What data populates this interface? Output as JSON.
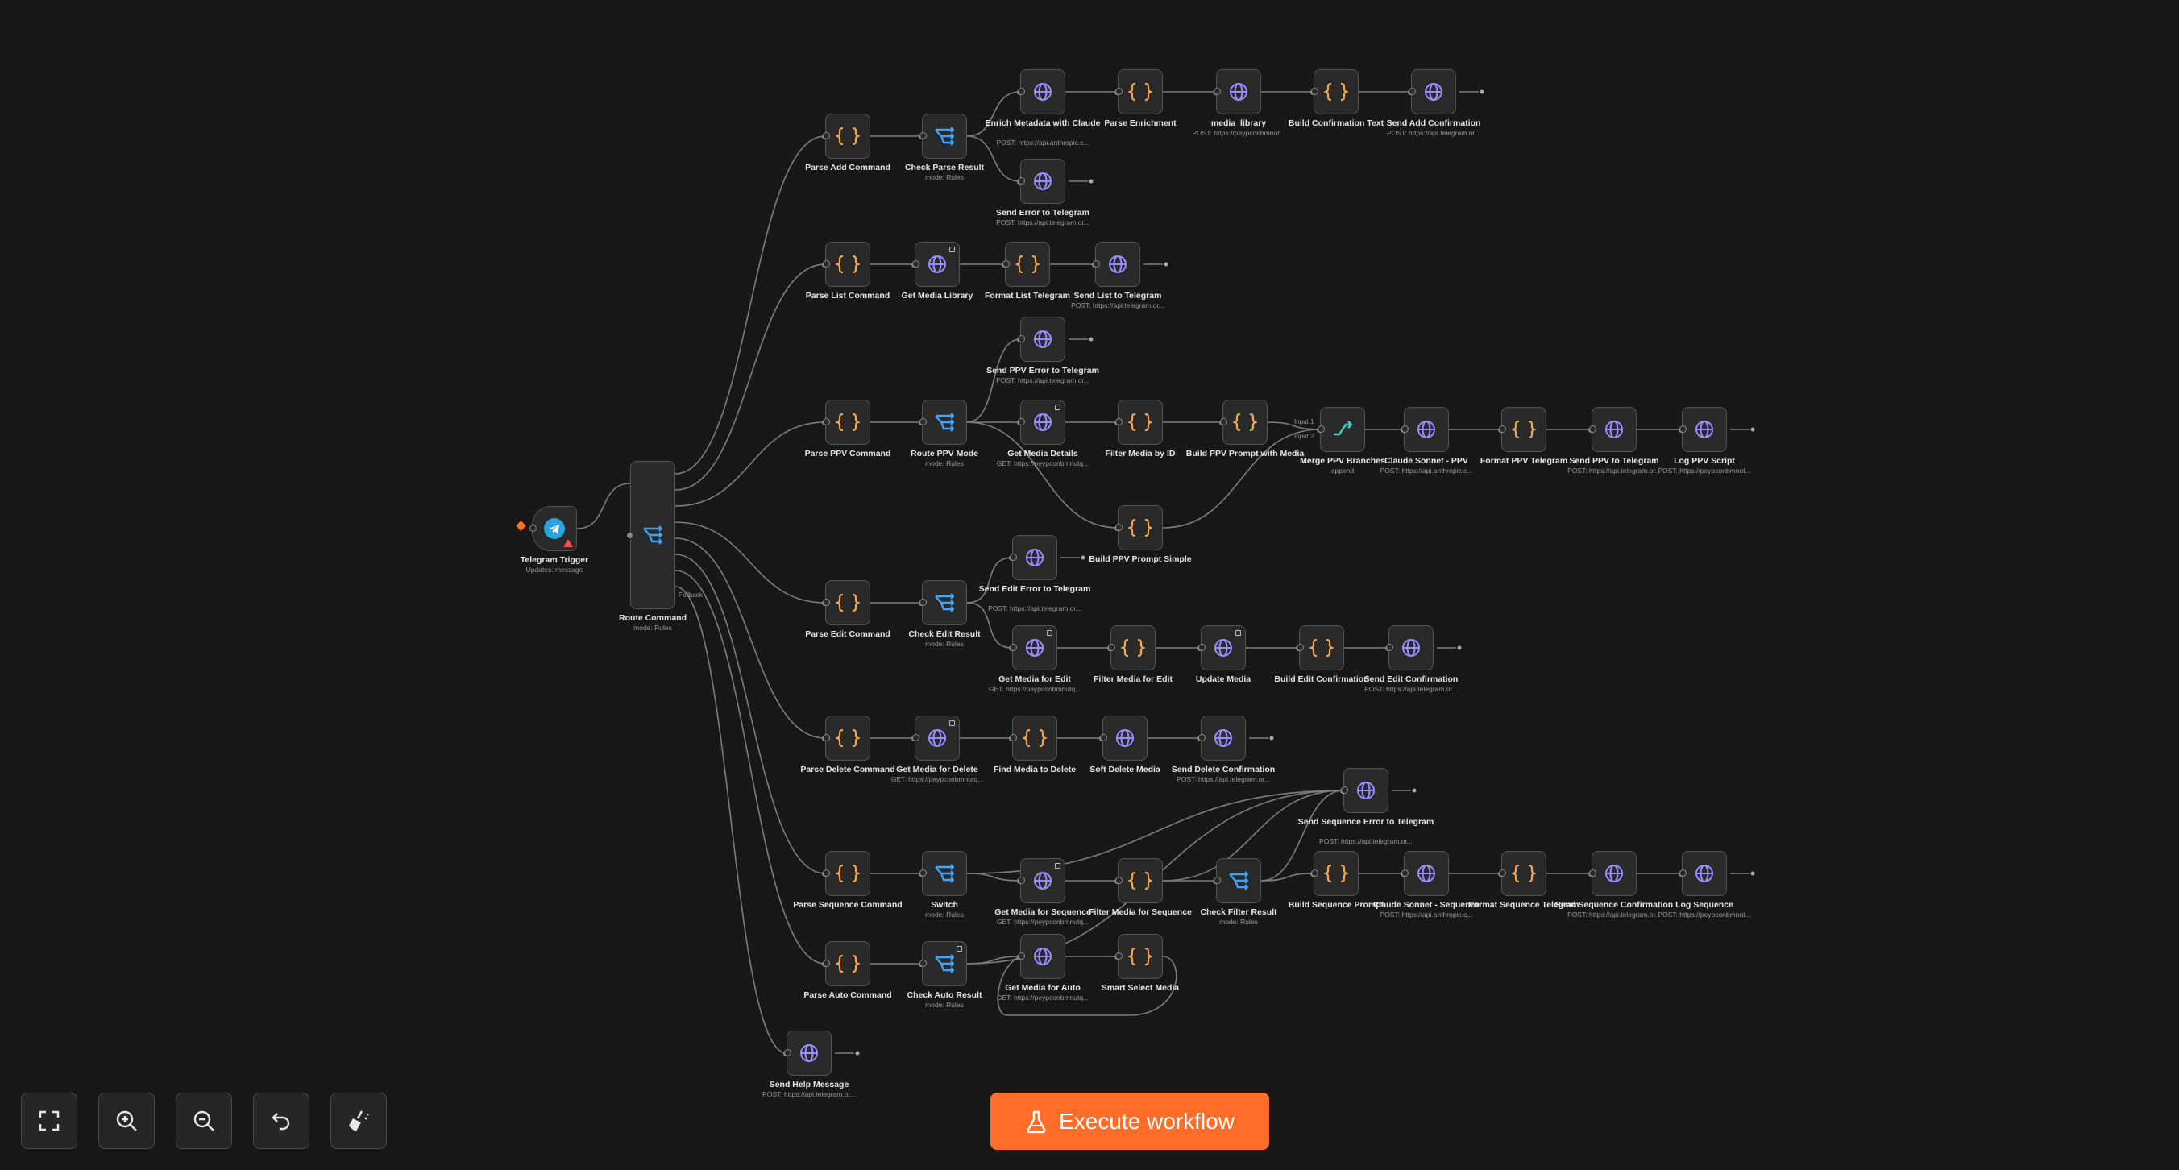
{
  "canvas": {
    "nodes": [
      {
        "id": "telegram-trigger",
        "label": "Telegram Trigger",
        "sub": "Updates: message",
        "icon": "telegram-icon",
        "kind": "trigger"
      },
      {
        "id": "route-command",
        "label": "Route Command",
        "sub": "mode: Rules",
        "icon": "switch-icon",
        "kind": "tall"
      },
      {
        "id": "parse-add-command",
        "label": "Parse Add Command",
        "sub": "",
        "icon": "code-icon"
      },
      {
        "id": "check-parse-result",
        "label": "Check Parse Result",
        "sub": "mode: Rules",
        "icon": "switch-icon"
      },
      {
        "id": "enrich-metadata",
        "label": "Enrich Metadata with Claude",
        "sub": "POST: https://api.anthropic.c...",
        "icon": "globe-icon"
      },
      {
        "id": "parse-enrichment",
        "label": "Parse Enrichment",
        "sub": "",
        "icon": "code-icon"
      },
      {
        "id": "media-library",
        "label": "media_library",
        "sub": "POST: https://peypconbmnut...",
        "icon": "globe-icon"
      },
      {
        "id": "build-confirmation-text",
        "label": "Build Confirmation Text",
        "sub": "",
        "icon": "code-icon"
      },
      {
        "id": "send-add-confirmation",
        "label": "Send Add Confirmation",
        "sub": "POST: https://api.telegram.or...",
        "icon": "globe-icon"
      },
      {
        "id": "send-error-to-telegram",
        "label": "Send Error to Telegram",
        "sub": "POST: https://api.telegram.or...",
        "icon": "globe-icon"
      },
      {
        "id": "parse-list-command",
        "label": "Parse List Command",
        "sub": "",
        "icon": "code-icon"
      },
      {
        "id": "get-media-library",
        "label": "Get Media Library",
        "sub": "",
        "icon": "globe-icon",
        "badge": true
      },
      {
        "id": "format-list-telegram",
        "label": "Format List Telegram",
        "sub": "",
        "icon": "code-icon"
      },
      {
        "id": "send-list-to-telegram",
        "label": "Send List to Telegram",
        "sub": "POST: https://api.telegram.or...",
        "icon": "globe-icon"
      },
      {
        "id": "send-ppv-error",
        "label": "Send PPV Error to Telegram",
        "sub": "POST: https://api.telegram.or...",
        "icon": "globe-icon"
      },
      {
        "id": "parse-ppv-command",
        "label": "Parse PPV Command",
        "sub": "",
        "icon": "code-icon"
      },
      {
        "id": "route-ppv-mode",
        "label": "Route PPV Mode",
        "sub": "mode: Rules",
        "icon": "switch-icon"
      },
      {
        "id": "get-media-details",
        "label": "Get Media Details",
        "sub": "GET: https://peypconbmnutq...",
        "icon": "globe-icon",
        "badge": true
      },
      {
        "id": "filter-media-by-id",
        "label": "Filter Media by ID",
        "sub": "",
        "icon": "code-icon"
      },
      {
        "id": "build-ppv-prompt-media",
        "label": "Build PPV Prompt with Media",
        "sub": "",
        "icon": "code-icon"
      },
      {
        "id": "merge-ppv-branches",
        "label": "Merge PPV Branches",
        "sub": "append",
        "icon": "merge-icon"
      },
      {
        "id": "claude-sonnet-ppv",
        "label": "Claude Sonnet - PPV",
        "sub": "POST: https://api.anthropic.c...",
        "icon": "globe-icon"
      },
      {
        "id": "format-ppv-telegram",
        "label": "Format PPV Telegram",
        "sub": "",
        "icon": "code-icon"
      },
      {
        "id": "send-ppv-to-telegram",
        "label": "Send PPV to Telegram",
        "sub": "POST: https://api.telegram.or...",
        "icon": "globe-icon"
      },
      {
        "id": "log-ppv-script",
        "label": "Log PPV Script",
        "sub": "POST: https://peypconbmnut...",
        "icon": "globe-icon"
      },
      {
        "id": "build-ppv-prompt-simple",
        "label": "Build PPV Prompt Simple",
        "sub": "",
        "icon": "code-icon"
      },
      {
        "id": "send-edit-error",
        "label": "Send Edit Error to Telegram",
        "sub": "POST: https://api.telegram.or...",
        "icon": "globe-icon"
      },
      {
        "id": "parse-edit-command",
        "label": "Parse Edit Command",
        "sub": "",
        "icon": "code-icon"
      },
      {
        "id": "check-edit-result",
        "label": "Check Edit Result",
        "sub": "mode: Rules",
        "icon": "switch-icon"
      },
      {
        "id": "get-media-for-edit",
        "label": "Get Media for Edit",
        "sub": "GET: https://peypconbmnutq...",
        "icon": "globe-icon",
        "badge": true
      },
      {
        "id": "filter-media-for-edit",
        "label": "Filter Media for Edit",
        "sub": "",
        "icon": "code-icon"
      },
      {
        "id": "update-media",
        "label": "Update Media",
        "sub": "",
        "icon": "globe-icon",
        "badge": true
      },
      {
        "id": "build-edit-confirmation",
        "label": "Build Edit Confirmation",
        "sub": "",
        "icon": "code-icon"
      },
      {
        "id": "send-edit-confirmation",
        "label": "Send Edit Confirmation",
        "sub": "POST: https://api.telegram.or...",
        "icon": "globe-icon"
      },
      {
        "id": "parse-delete-command",
        "label": "Parse Delete Command",
        "sub": "",
        "icon": "code-icon"
      },
      {
        "id": "get-media-for-delete",
        "label": "Get Media for Delete",
        "sub": "GET: https://peypconbmnutq...",
        "icon": "globe-icon",
        "badge": true
      },
      {
        "id": "find-media-to-delete",
        "label": "Find Media to Delete",
        "sub": "",
        "icon": "code-icon"
      },
      {
        "id": "soft-delete-media",
        "label": "Soft Delete Media",
        "sub": "",
        "icon": "globe-icon"
      },
      {
        "id": "send-delete-confirmation",
        "label": "Send Delete Confirmation",
        "sub": "POST: https://api.telegram.or...",
        "icon": "globe-icon"
      },
      {
        "id": "send-sequence-error",
        "label": "Send Sequence Error to Telegram",
        "sub": "POST: https://api.telegram.or...",
        "icon": "globe-icon"
      },
      {
        "id": "parse-sequence-command",
        "label": "Parse Sequence Command",
        "sub": "",
        "icon": "code-icon"
      },
      {
        "id": "switch",
        "label": "Switch",
        "sub": "mode: Rules",
        "icon": "switch-icon"
      },
      {
        "id": "get-media-for-sequence",
        "label": "Get Media for Sequence",
        "sub": "GET: https://peypconbmnutq...",
        "icon": "globe-icon",
        "badge": true
      },
      {
        "id": "filter-media-for-sequence",
        "label": "Filter Media for Sequence",
        "sub": "",
        "icon": "code-icon"
      },
      {
        "id": "check-filter-result",
        "label": "Check Filter Result",
        "sub": "mode: Rules",
        "icon": "switch-icon"
      },
      {
        "id": "build-sequence-prompt",
        "label": "Build Sequence Prompt",
        "sub": "",
        "icon": "code-icon"
      },
      {
        "id": "claude-sonnet-sequence",
        "label": "Claude Sonnet - Sequence",
        "sub": "POST: https://api.anthropic.c...",
        "icon": "globe-icon"
      },
      {
        "id": "format-sequence-telegram",
        "label": "Format Sequence Telegram",
        "sub": "",
        "icon": "code-icon"
      },
      {
        "id": "send-sequence-confirmation",
        "label": "Send Sequence Confirmation",
        "sub": "POST: https://api.telegram.or...",
        "icon": "globe-icon"
      },
      {
        "id": "log-sequence",
        "label": "Log Sequence",
        "sub": "POST: https://peypconbmnut...",
        "icon": "globe-icon"
      },
      {
        "id": "parse-auto-command",
        "label": "Parse Auto Command",
        "sub": "",
        "icon": "code-icon"
      },
      {
        "id": "check-auto-result",
        "label": "Check Auto Result",
        "sub": "mode: Rules",
        "icon": "switch-icon",
        "badge": true
      },
      {
        "id": "get-media-for-auto",
        "label": "Get Media for Auto",
        "sub": "GET: https://peypconbmnutq...",
        "icon": "globe-icon"
      },
      {
        "id": "smart-select-media",
        "label": "Smart Select Media",
        "sub": "",
        "icon": "code-icon"
      },
      {
        "id": "send-help-message",
        "label": "Send Help Message",
        "sub": "POST: https://api.telegram.or...",
        "icon": "globe-icon"
      }
    ],
    "merge_inputs": [
      "Input 1",
      "Input 2"
    ],
    "fallback_label": "Fallback"
  },
  "toolbar": {
    "fit_view": "fit-view-icon",
    "zoom_in": "zoom-in-icon",
    "zoom_out": "zoom-out-icon",
    "reset_zoom": "undo-icon",
    "tidy_up": "broom-icon"
  },
  "execute_button": {
    "label": "Execute workflow",
    "icon": "flask-icon"
  },
  "colors": {
    "background": "#181818",
    "node": "#2a2a2a",
    "code_icon": "#f5a64c",
    "globe_icon": "#9b8cff",
    "switch_icon": "#3ba4ff",
    "accent": "#ff6d28"
  }
}
